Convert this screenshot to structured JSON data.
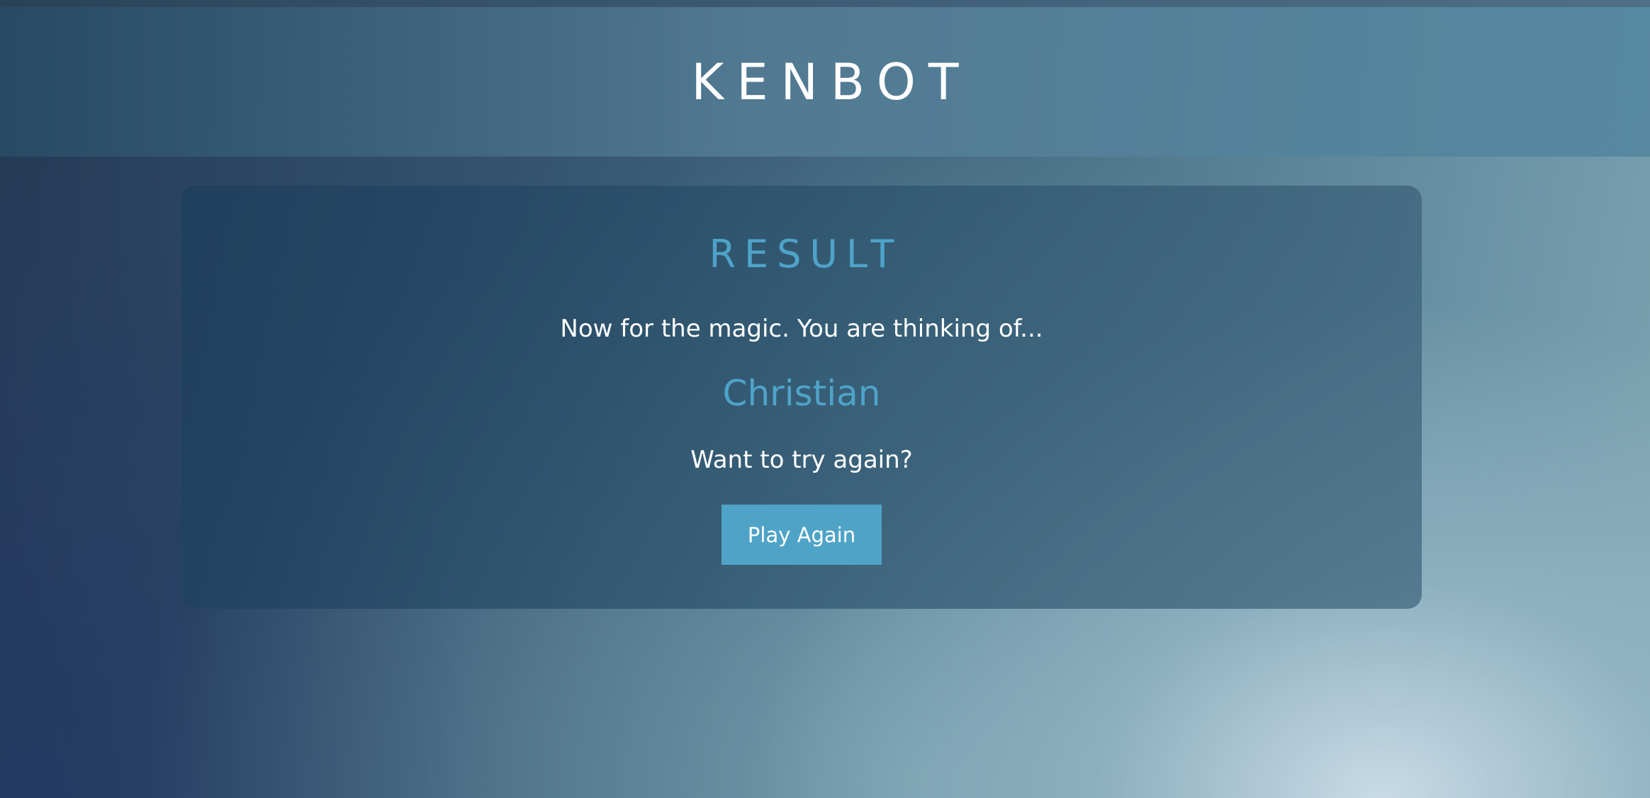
{
  "header": {
    "brand": "KENBOT"
  },
  "result": {
    "title": "RESULT",
    "intro": "Now for the magic. You are thinking of...",
    "answer": "Christian",
    "prompt": "Want to try again?",
    "play_again_label": "Play Again"
  },
  "colors": {
    "accent": "#4fa3c9",
    "text": "#ffffff"
  }
}
